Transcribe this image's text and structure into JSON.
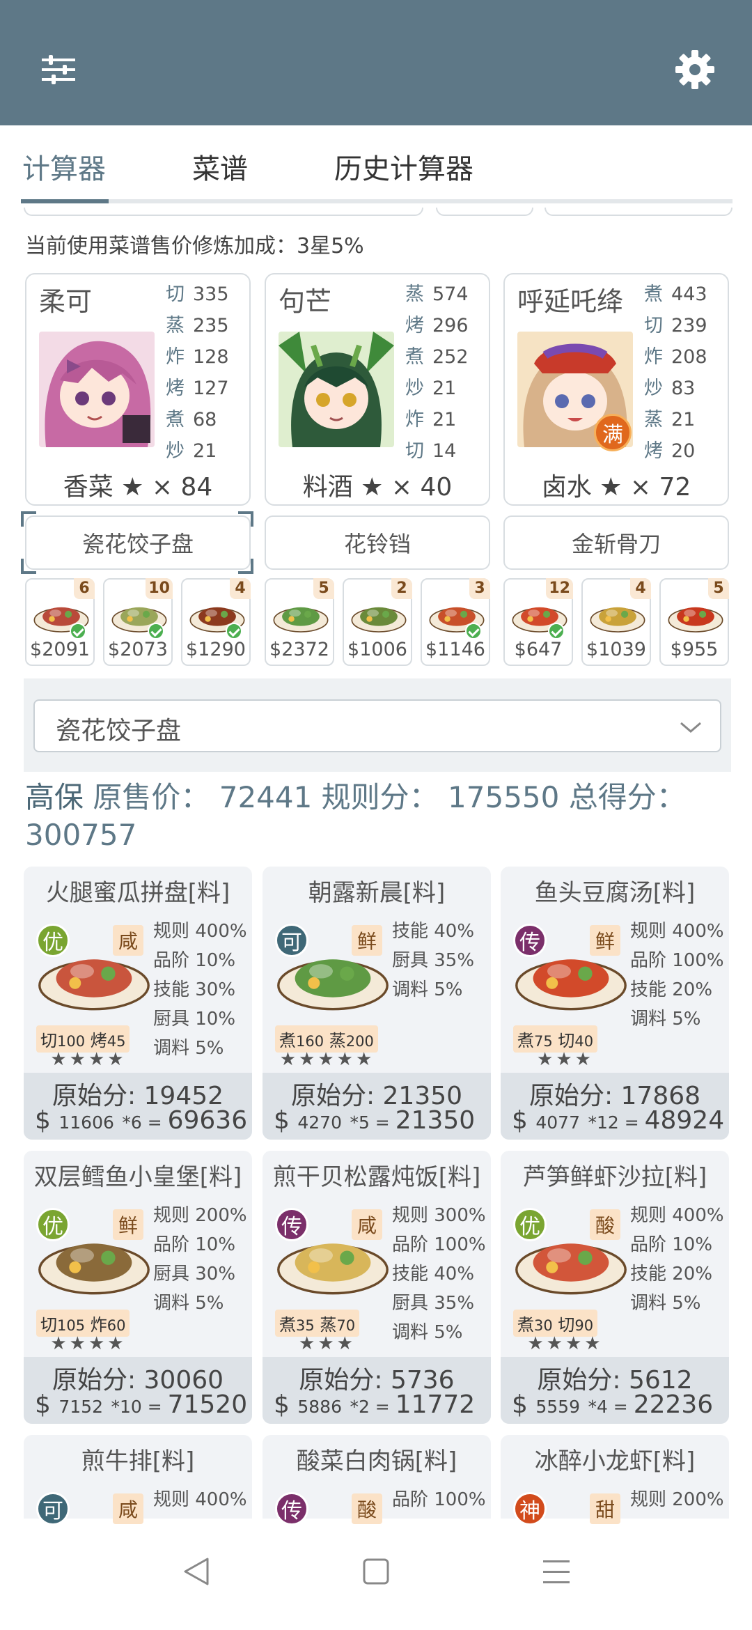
{
  "tabs": [
    "计算器",
    "菜谱",
    "历史计算器"
  ],
  "bonus_text": "当前使用菜谱售价修炼加成：3星5%",
  "chefs": [
    {
      "name": "柔可",
      "skills": [
        [
          "切",
          "335"
        ],
        [
          "蒸",
          "235"
        ],
        [
          "炸",
          "128"
        ],
        [
          "烤",
          "127"
        ],
        [
          "煮",
          "68"
        ],
        [
          "炒",
          "21"
        ]
      ],
      "ingredient": "香菜 ★ × 84"
    },
    {
      "name": "句芒",
      "skills": [
        [
          "蒸",
          "574"
        ],
        [
          "烤",
          "296"
        ],
        [
          "煮",
          "252"
        ],
        [
          "炒",
          "21"
        ],
        [
          "炸",
          "21"
        ],
        [
          "切",
          "14"
        ]
      ],
      "ingredient": "料酒 ★ × 40"
    },
    {
      "name": "呼延吒绛",
      "skills": [
        [
          "煮",
          "443"
        ],
        [
          "切",
          "239"
        ],
        [
          "炸",
          "208"
        ],
        [
          "炒",
          "83"
        ],
        [
          "蒸",
          "21"
        ],
        [
          "烤",
          "20"
        ]
      ],
      "ingredient": "卤水 ★ × 72",
      "badge": "满"
    }
  ],
  "equipment": [
    "瓷花饺子盘",
    "花铃铛",
    "金斩骨刀"
  ],
  "stock": [
    {
      "count": "6",
      "price": "$2091",
      "check": true,
      "color": "#b94a3a"
    },
    {
      "count": "10",
      "price": "$2073",
      "check": true,
      "color": "#9aa65a"
    },
    {
      "count": "4",
      "price": "$1290",
      "check": true,
      "color": "#8c3a1e"
    },
    {
      "count": "5",
      "price": "$2372",
      "check": false,
      "color": "#5f9a44"
    },
    {
      "count": "2",
      "price": "$1006",
      "check": false,
      "color": "#6a8a3a"
    },
    {
      "count": "3",
      "price": "$1146",
      "check": true,
      "color": "#c8502a"
    },
    {
      "count": "12",
      "price": "$647",
      "check": true,
      "color": "#d24a2a"
    },
    {
      "count": "4",
      "price": "$1039",
      "check": false,
      "color": "#c9a23a"
    },
    {
      "count": "5",
      "price": "$955",
      "check": false,
      "color": "#c8381e"
    }
  ],
  "dropdown": {
    "value": "瓷花饺子盘"
  },
  "summary": {
    "name": "高保",
    "text": "原售价： 72441 规则分： 175550 总得分： 300757"
  },
  "dishes": [
    {
      "title": "火腿蜜瓜拼盘[料]",
      "grade": "优",
      "gcls": "g-you",
      "flavor": "咸",
      "req": [
        [
          "切",
          "100"
        ],
        [
          "烤",
          "45"
        ]
      ],
      "stars": "★★★★",
      "bonus": [
        "规则 400%",
        "品阶 10%",
        "技能 30%",
        "厨具 10%",
        "调料 5%"
      ],
      "orig": "原始分: 19452",
      "calc_price": "11606",
      "calc_mult": "*6",
      "calc_total": "69636",
      "color": "#c9553d"
    },
    {
      "title": "朝露新晨[料]",
      "grade": "可",
      "gcls": "g-ke",
      "flavor": "鲜",
      "req": [
        [
          "煮",
          "160"
        ],
        [
          "蒸",
          "200"
        ]
      ],
      "stars": "★★★★★",
      "bonus": [
        "技能 40%",
        "厨具 35%",
        "调料 5%"
      ],
      "orig": "原始分: 21350",
      "calc_price": "4270",
      "calc_mult": "*5",
      "calc_total": "21350",
      "color": "#5f9a44"
    },
    {
      "title": "鱼头豆腐汤[料]",
      "grade": "传",
      "gcls": "g-chuan",
      "flavor": "鲜",
      "req": [
        [
          "煮",
          "75"
        ],
        [
          "切",
          "40"
        ]
      ],
      "stars": "★★★",
      "bonus": [
        "规则 400%",
        "品阶 100%",
        "技能 20%",
        "调料 5%"
      ],
      "orig": "原始分: 17868",
      "calc_price": "4077",
      "calc_mult": "*12",
      "calc_total": "48924",
      "color": "#d24a2a"
    },
    {
      "title": "双层鳕鱼小皇堡[料]",
      "grade": "优",
      "gcls": "g-you",
      "flavor": "鲜",
      "req": [
        [
          "切",
          "105"
        ],
        [
          "炸",
          "60"
        ]
      ],
      "stars": "★★★★",
      "bonus": [
        "规则 200%",
        "品阶 10%",
        "厨具 30%",
        "调料 5%"
      ],
      "orig": "原始分: 30060",
      "calc_price": "7152",
      "calc_mult": "*10",
      "calc_total": "71520",
      "color": "#8a6a3a"
    },
    {
      "title": "煎干贝松露炖饭[料]",
      "grade": "传",
      "gcls": "g-chuan",
      "flavor": "咸",
      "req": [
        [
          "煮",
          "35"
        ],
        [
          "蒸",
          "70"
        ]
      ],
      "stars": "★★★",
      "bonus": [
        "规则 300%",
        "品阶 100%",
        "技能 40%",
        "厨具 35%",
        "调料 5%"
      ],
      "orig": "原始分: 5736",
      "calc_price": "5886",
      "calc_mult": "*2",
      "calc_total": "11772",
      "color": "#d8b65a"
    },
    {
      "title": "芦笋鲜虾沙拉[料]",
      "grade": "优",
      "gcls": "g-you",
      "flavor": "酸",
      "req": [
        [
          "煮",
          "30"
        ],
        [
          "切",
          "90"
        ]
      ],
      "stars": "★★★★",
      "bonus": [
        "规则 400%",
        "品阶 10%",
        "技能 20%",
        "调料 5%"
      ],
      "orig": "原始分: 5612",
      "calc_price": "5559",
      "calc_mult": "*4",
      "calc_total": "22236",
      "color": "#d2563a"
    },
    {
      "title": "煎牛排[料]",
      "grade": "可",
      "gcls": "g-ke",
      "flavor": "咸",
      "req": [],
      "stars": "",
      "bonus": [
        "规则 400%"
      ],
      "orig": "",
      "calc_price": "",
      "calc_mult": "",
      "calc_total": "",
      "color": "#8c3a1e"
    },
    {
      "title": "酸菜白肉锅[料]",
      "grade": "传",
      "gcls": "g-chuan",
      "flavor": "酸",
      "req": [],
      "stars": "",
      "bonus": [
        "品阶 100%"
      ],
      "orig": "",
      "calc_price": "",
      "calc_mult": "",
      "calc_total": "",
      "color": "#c9a23a"
    },
    {
      "title": "冰醉小龙虾[料]",
      "grade": "神",
      "gcls": "g-shen",
      "flavor": "甜",
      "req": [],
      "stars": "",
      "bonus": [
        "规则 200%"
      ],
      "orig": "",
      "calc_price": "",
      "calc_mult": "",
      "calc_total": "",
      "color": "#c8381e"
    }
  ],
  "icons": {
    "filter": "sliders-icon",
    "settings": "gear-icon",
    "back": "back-icon",
    "home": "home-icon",
    "menu": "menu-icon"
  }
}
